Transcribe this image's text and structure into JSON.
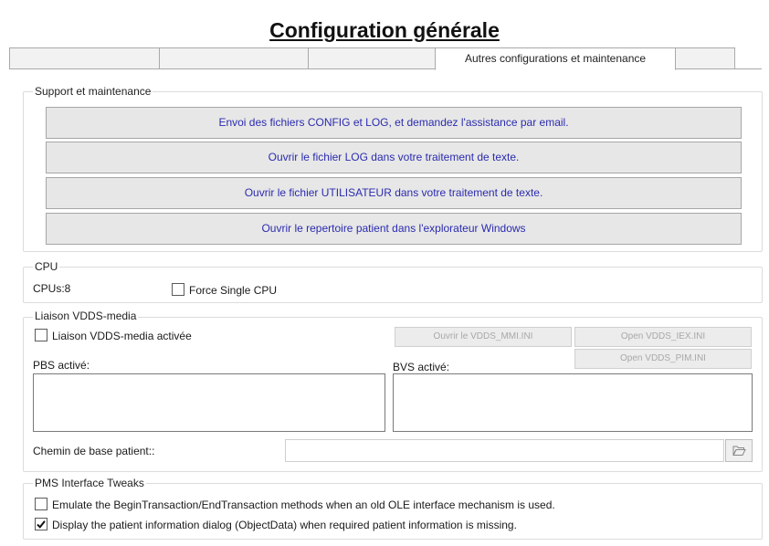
{
  "title": "Configuration générale",
  "tabs": [
    {
      "label": ""
    },
    {
      "label": ""
    },
    {
      "label": ""
    },
    {
      "label": "Autres configurations et maintenance"
    },
    {
      "label": ""
    }
  ],
  "support": {
    "label": "Support et maintenance",
    "buttons": [
      "Envoi des fichiers CONFIG et LOG, et demandez l'assistance par email.",
      "Ouvrir le fichier LOG dans votre traitement de texte.",
      "Ouvrir le fichier UTILISATEUR dans votre traitement de texte.",
      "Ouvrir le repertoire patient dans l'explorateur Windows"
    ]
  },
  "cpu": {
    "label": "CPU",
    "count_text": "CPUs:8",
    "force_single_label": "Force Single CPU",
    "force_single_checked": false
  },
  "vdds": {
    "label": "Liaison VDDS-media",
    "activated_label": "Liaison VDDS-media activée",
    "activated_checked": false,
    "open_mmi": "Ouvrir le VDDS_MMI.INI",
    "open_iex": "Open VDDS_IEX.INI",
    "open_pim": "Open VDDS_PIM.INI",
    "pbs_label": "PBS activé:",
    "bvs_label": "BVS activé:",
    "chemin_label": "Chemin de base patient::",
    "chemin_value": ""
  },
  "pms": {
    "label": "PMS Interface Tweaks",
    "emulate_label": "Emulate the BeginTransaction/EndTransaction methods when an old OLE interface mechanism is used.",
    "emulate_checked": false,
    "display_label": "Display the patient information dialog (ObjectData) when required patient information is missing.",
    "display_checked": true
  },
  "icons": {
    "folder": "folder-open-icon",
    "check": "checkmark-icon"
  },
  "colors": {
    "button_text": "#2b2bb0",
    "disabled_text": "#a8a8a8"
  }
}
